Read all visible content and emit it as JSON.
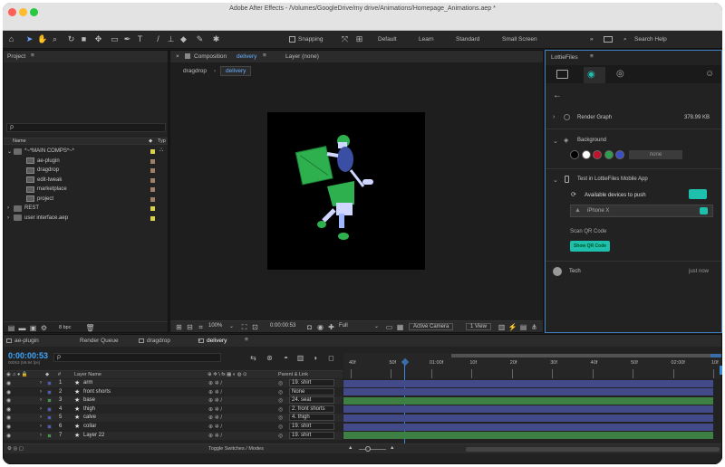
{
  "window": {
    "title": "Adobe After Effects - /Volumes/GoogleDrive/my drive/Animations/Homepage_Animations.aep *"
  },
  "toolbar": {
    "snapping": "Snapping",
    "workspaces": [
      "Default",
      "Learn",
      "Standard",
      "Small Screen"
    ],
    "search_help": "Search Help"
  },
  "project": {
    "panel_title": "Project",
    "search_placeholder": "ρ",
    "col_name": "Name",
    "col_type": "Typ",
    "items": [
      {
        "label": "*~*MAIN COMPS*~*",
        "kind": "folder",
        "swatch": "#d9d14a"
      },
      {
        "label": "ae-plugin",
        "kind": "comp",
        "swatch": "#a07f69"
      },
      {
        "label": "dragdrop",
        "kind": "comp",
        "swatch": "#a07f69"
      },
      {
        "label": "edit-tweak",
        "kind": "comp",
        "swatch": "#a07f69"
      },
      {
        "label": "marketplace",
        "kind": "comp",
        "swatch": "#a07f69"
      },
      {
        "label": "project",
        "kind": "comp",
        "swatch": "#a07f69"
      },
      {
        "label": "REST",
        "kind": "folder",
        "swatch": "#d9d14a"
      },
      {
        "label": "user interface.aep",
        "kind": "folder",
        "swatch": "#d9d14a"
      }
    ],
    "bpc": "8 bpc"
  },
  "composition": {
    "tab_prefix": "Composition",
    "tab_name": "delivery",
    "layer_tab": "Layer (none)",
    "breadcrumbs": [
      "dragdrop",
      "delivery"
    ],
    "zoom": "100%",
    "timecode": "0:00:00:53",
    "resolution": "Full",
    "camera": "Active Camera",
    "view": "1 View"
  },
  "lottie": {
    "panel_title": "LottieFiles",
    "render_graph": "Render Graph",
    "render_size": "378.99 KB",
    "background": "Background",
    "bg_colors": [
      "#000000",
      "#ffffff",
      "#c0142a",
      "#2f9e4f",
      "#3a4fc4"
    ],
    "bg_none": "none",
    "test_title": "Test in LottieFiles Mobile App",
    "devices_label": "Available devices to push",
    "device": "iPhone X",
    "scan_qr": "Scan QR Code",
    "show_qr": "Show QR Code",
    "user": "Tech",
    "time": "just now",
    "accent": "#1fbfae"
  },
  "timeline": {
    "tabs": [
      "ae-plugin",
      "Render Queue",
      "dragdrop",
      "delivery"
    ],
    "timecode": "0:00:00:53",
    "timecode_sub": "00053 (59.94 fps)",
    "search_placeholder": "ρ",
    "col_hash": "#",
    "col_layer_name": "Layer Name",
    "col_parent": "Parent & Link",
    "ruler_labels": [
      "40f",
      "50f",
      "01:00f",
      "10f",
      "20f",
      "30f",
      "40f",
      "50f",
      "02:00f",
      "10f"
    ],
    "layers": [
      {
        "num": "1",
        "name": "arm",
        "parent": "19. shirt",
        "color": "#4b5bbf"
      },
      {
        "num": "2",
        "name": "front shorts",
        "parent": "None",
        "color": "#4b5bbf"
      },
      {
        "num": "3",
        "name": "base",
        "parent": "24. seat",
        "color": "#3d9a4a"
      },
      {
        "num": "4",
        "name": "thigh",
        "parent": "2. front shorts",
        "color": "#4b5bbf"
      },
      {
        "num": "5",
        "name": "calve",
        "parent": "4. thigh",
        "color": "#4b5bbf"
      },
      {
        "num": "6",
        "name": "collar",
        "parent": "19. shirt",
        "color": "#4b5bbf"
      },
      {
        "num": "7",
        "name": "Layer 22",
        "parent": "19. shirt",
        "color": "#3d9a4a"
      }
    ],
    "footer": "Toggle Switches / Modes"
  }
}
